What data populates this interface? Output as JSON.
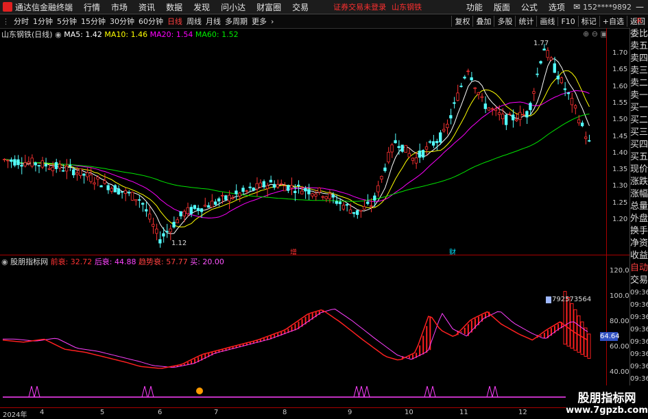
{
  "menubar": {
    "app_title": "通达信金融终端",
    "items": [
      "行情",
      "市场",
      "资讯",
      "数据",
      "发现",
      "问小达",
      "财富圈",
      "交易"
    ],
    "warning": "证券交易未登录",
    "stock": "山东钢铁",
    "right_items": [
      "功能",
      "版面",
      "公式",
      "选项"
    ],
    "user": "152****9892"
  },
  "toolbar": {
    "periods": [
      "分时",
      "1分钟",
      "5分钟",
      "15分钟",
      "30分钟",
      "60分钟",
      "日线",
      "周线",
      "月线",
      "多周期",
      "更多"
    ],
    "active": "日线",
    "buttons": [
      "复权",
      "叠加",
      "多股",
      "统计",
      "画线",
      "F10",
      "标记",
      "+自选",
      "返回"
    ]
  },
  "main_legend": {
    "title": "山东钢铁(日线)",
    "ma5": "MA5: 1.42",
    "ma10": "MA10: 1.46",
    "ma20": "MA20: 1.54",
    "ma60": "MA60: 1.52"
  },
  "price_axis": [
    "1.70",
    "1.65",
    "1.60",
    "1.55",
    "1.50",
    "1.45",
    "1.40",
    "1.35",
    "1.30",
    "1.25",
    "1.20"
  ],
  "annotations": {
    "high": "1.77",
    "low": "1.12",
    "mark1": "增",
    "mark2": "财"
  },
  "indicator_legend": {
    "title": "股朋指标网",
    "qian": "前衰: 32.72",
    "hou": "后衰: 44.88",
    "qushi": "趋势衰: 57.77",
    "mai": "买: 20.00"
  },
  "indicator_axis": [
    "120.00",
    "100.00",
    "80.00",
    "60.00",
    "40.00"
  ],
  "indicator_value_tag": "64.64",
  "indicator_note": "792573564",
  "date_axis": [
    "2024年",
    "4",
    "5",
    "6",
    "7",
    "8",
    "9",
    "10",
    "11",
    "12"
  ],
  "right_panel": [
    "委比",
    "卖五",
    "卖四",
    "卖三",
    "卖二",
    "卖一",
    "买一",
    "买二",
    "买三",
    "买四",
    "买五",
    "现价",
    "涨跌",
    "涨幅",
    "总量",
    "外盘",
    "换手",
    "净资",
    "收益",
    "自动",
    "交易",
    "09:36",
    "09:36",
    "09:36",
    "09:36",
    "09:36",
    "09:36",
    "09:36",
    "09:36",
    "09:36",
    "09:36"
  ],
  "watermark": {
    "line1": "股朋指标网",
    "line2": "www.7gpzb.com"
  },
  "colors": {
    "up": "#ff3232",
    "down": "#54ffff",
    "ma5": "#ffffff",
    "ma10": "#ffff00",
    "ma20": "#ff00ff",
    "ma60": "#00e600"
  }
}
